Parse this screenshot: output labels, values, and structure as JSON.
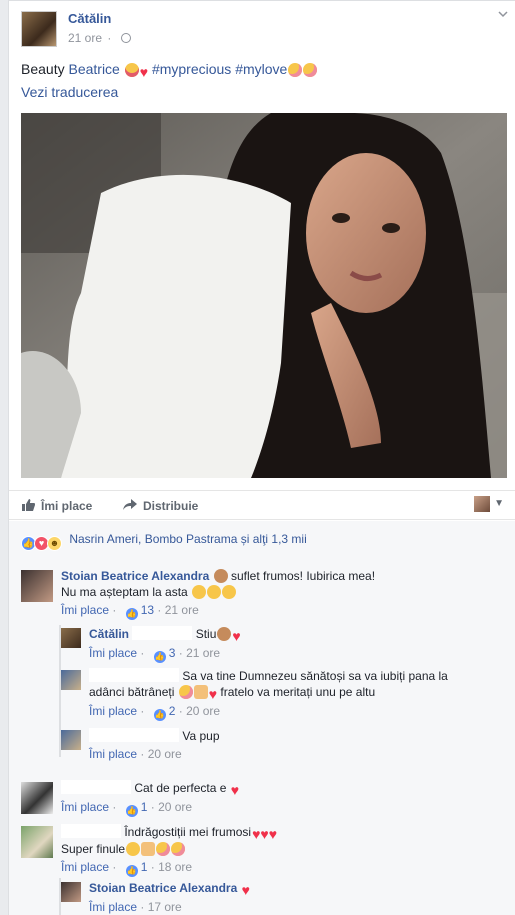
{
  "post": {
    "author": "Cătălin",
    "time": "21 ore",
    "text_prefix": "Beauty ",
    "tagged_name": "Beatrice",
    "hashtags": "#myprecious #mylove",
    "see_translation": "Vezi traducerea"
  },
  "actions": {
    "like": "Îmi place",
    "share": "Distribuie"
  },
  "reactions": {
    "summary": "Nasrin Ameri, Bombo Pastrama și alţi 1,3 mii"
  },
  "comments": [
    {
      "name": "Stoian Beatrice Alexandra",
      "text_line1": "suflet frumos! Iubirica mea!",
      "text_line2": "Nu ma așteptam la asta",
      "like_label": "Îmi place",
      "likes": "13",
      "time": "21 ore"
    },
    {
      "name": "Cătălin",
      "text": "Stiu",
      "like_label": "Îmi place",
      "likes": "3",
      "time": "21 ore"
    },
    {
      "name": "",
      "text_line1": "Sa va tine Dumnezeu sănătoși sa va iubiți pana la",
      "text_line2a": "adânci bătrâneți",
      "text_line2b": "fratelo va meritați unu pe altu",
      "like_label": "Îmi place",
      "likes": "2",
      "time": "20 ore"
    },
    {
      "name": "",
      "text": "Va pup",
      "like_label": "Îmi place",
      "time": "20 ore"
    },
    {
      "name": "",
      "text": "Cat de perfecta e",
      "like_label": "Îmi place",
      "likes": "1",
      "time": "20 ore"
    },
    {
      "name": "",
      "text_line1": "Îndrăgostiții mei frumosi",
      "text_line2": "Super finule",
      "like_label": "Îmi place",
      "likes": "1",
      "time": "18 ore"
    },
    {
      "name": "Stoian Beatrice Alexandra",
      "like_label": "Îmi place",
      "time": "17 ore"
    }
  ],
  "icons": {
    "globe": "globe-icon",
    "like": "thumbs-up-icon",
    "share": "share-arrow-icon",
    "heart": "♥"
  },
  "colors": {
    "link": "#365899",
    "accent": "#4267b2",
    "like_blue": "#5890ff",
    "love_red": "#f25268"
  }
}
